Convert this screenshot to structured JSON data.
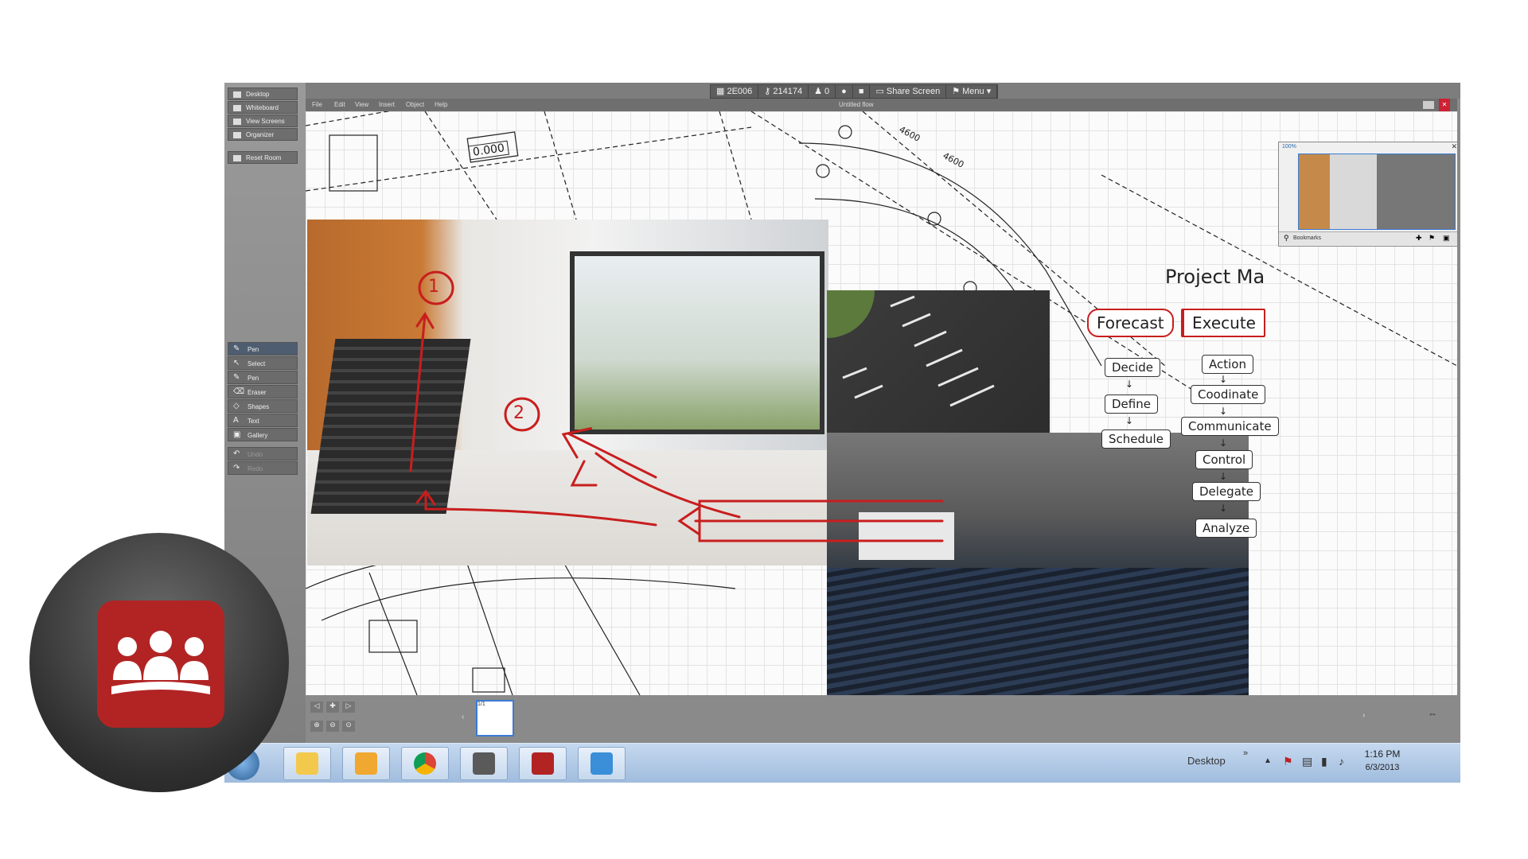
{
  "room_bar": {
    "room_id": "2E006",
    "room_key": "214174",
    "participants": "0",
    "share_screen": "Share Screen",
    "menu": "Menu"
  },
  "left_panel": {
    "nav": [
      "Desktop",
      "Whiteboard",
      "View Screens",
      "Organizer"
    ],
    "reset_room": "Reset Room",
    "tools": [
      "Pen",
      "Select",
      "Pen",
      "Eraser",
      "Shapes",
      "Text",
      "Gallery"
    ],
    "undo": "Undo",
    "redo": "Redo"
  },
  "whiteboard": {
    "menus": [
      "File",
      "Edit",
      "View",
      "Insert",
      "Object",
      "Help"
    ],
    "title": "Untitled flow",
    "page_indicator": "1/1"
  },
  "minimap": {
    "zoom": "100%",
    "bookmarks": "Bookmarks"
  },
  "blueprint_labels": [
    "0.000",
    "4600",
    "4600"
  ],
  "annotations": {
    "marker1": "1",
    "marker2": "2",
    "title": "Project Ma",
    "forecast": "Forecast",
    "execute": "Execute",
    "forecast_steps": [
      "Decide",
      "Define",
      "Schedule"
    ],
    "execute_steps": [
      "Action",
      "Coodinate",
      "Communicate",
      "Control",
      "Delegate",
      "Analyze"
    ]
  },
  "taskbar": {
    "desktop_label": "Desktop",
    "time": "1:16 PM",
    "date": "6/3/2013"
  },
  "colors": {
    "annotation_red": "#c81e1e",
    "app_red": "#b22424",
    "taskbar_blue": "#b3cbe6"
  }
}
